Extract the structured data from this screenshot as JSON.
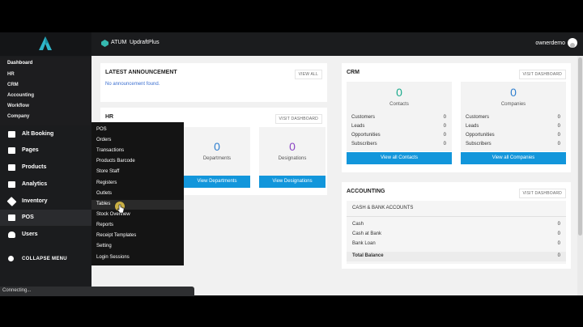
{
  "topbar": {
    "atum_label": "ATUM",
    "updraft_label": "UpdraftPlus",
    "user_name": "ownerdemo"
  },
  "sidebar": {
    "top_items": [
      "Dashboard",
      "HR",
      "CRM",
      "Accounting",
      "Workflow",
      "Company"
    ],
    "main_items": [
      {
        "label": "Alt Booking",
        "icon": "calendar-icon"
      },
      {
        "label": "Pages",
        "icon": "pages-icon"
      },
      {
        "label": "Products",
        "icon": "box-icon"
      },
      {
        "label": "Analytics",
        "icon": "chart-icon"
      },
      {
        "label": "Inventory",
        "icon": "tag-icon"
      },
      {
        "label": "POS",
        "icon": "pos-icon"
      },
      {
        "label": "Users",
        "icon": "user-icon"
      }
    ],
    "collapse_label": "COLLAPSE MENU"
  },
  "pos_menu": [
    "POS",
    "Orders",
    "Transactions",
    "Products Barcode",
    "Store Staff",
    "Registers",
    "Outlets",
    "Tables",
    "Stock Overview",
    "Reports",
    "Receipt Templates",
    "Setting",
    "Login Sessions"
  ],
  "announcement": {
    "title": "LATEST ANNOUNCEMENT",
    "view_all": "VIEW ALL",
    "empty": "No announcement found."
  },
  "hr": {
    "title": "HR",
    "view_dashboard": "VISIT DASHBOARD",
    "departments_count": "0",
    "departments_label": "Departments",
    "departments_btn": "View Departments",
    "designations_count": "0",
    "designations_label": "Designations",
    "designations_btn": "View Designations"
  },
  "crm": {
    "title": "CRM",
    "view_dashboard": "VISIT DASHBOARD",
    "contacts_count": "0",
    "contacts_label": "Contacts",
    "contacts_rows": [
      {
        "k": "Customers",
        "v": "0"
      },
      {
        "k": "Leads",
        "v": "0"
      },
      {
        "k": "Opportunities",
        "v": "0"
      },
      {
        "k": "Subscribers",
        "v": "0"
      }
    ],
    "contacts_btn": "View all Contacts",
    "companies_count": "0",
    "companies_label": "Companies",
    "companies_rows": [
      {
        "k": "Customers",
        "v": "0"
      },
      {
        "k": "Leads",
        "v": "0"
      },
      {
        "k": "Opportunities",
        "v": "0"
      },
      {
        "k": "Subscribers",
        "v": "0"
      }
    ],
    "companies_btn": "View all Companies"
  },
  "accounting": {
    "title": "ACCOUNTING",
    "view_dashboard": "VISIT DASHBOARD",
    "section": "CASH & BANK ACCOUNTS",
    "rows": [
      {
        "k": "Cash",
        "v": "0"
      },
      {
        "k": "Cash at Bank",
        "v": "0"
      },
      {
        "k": "Bank Loan",
        "v": "0"
      }
    ],
    "total_label": "Total Balance",
    "total_value": "0"
  },
  "status_text": "Connecting...",
  "colors": {
    "accent": "#1296db",
    "green": "#1aaa8c",
    "purple": "#8b45c4",
    "blue": "#2f7fcf"
  }
}
